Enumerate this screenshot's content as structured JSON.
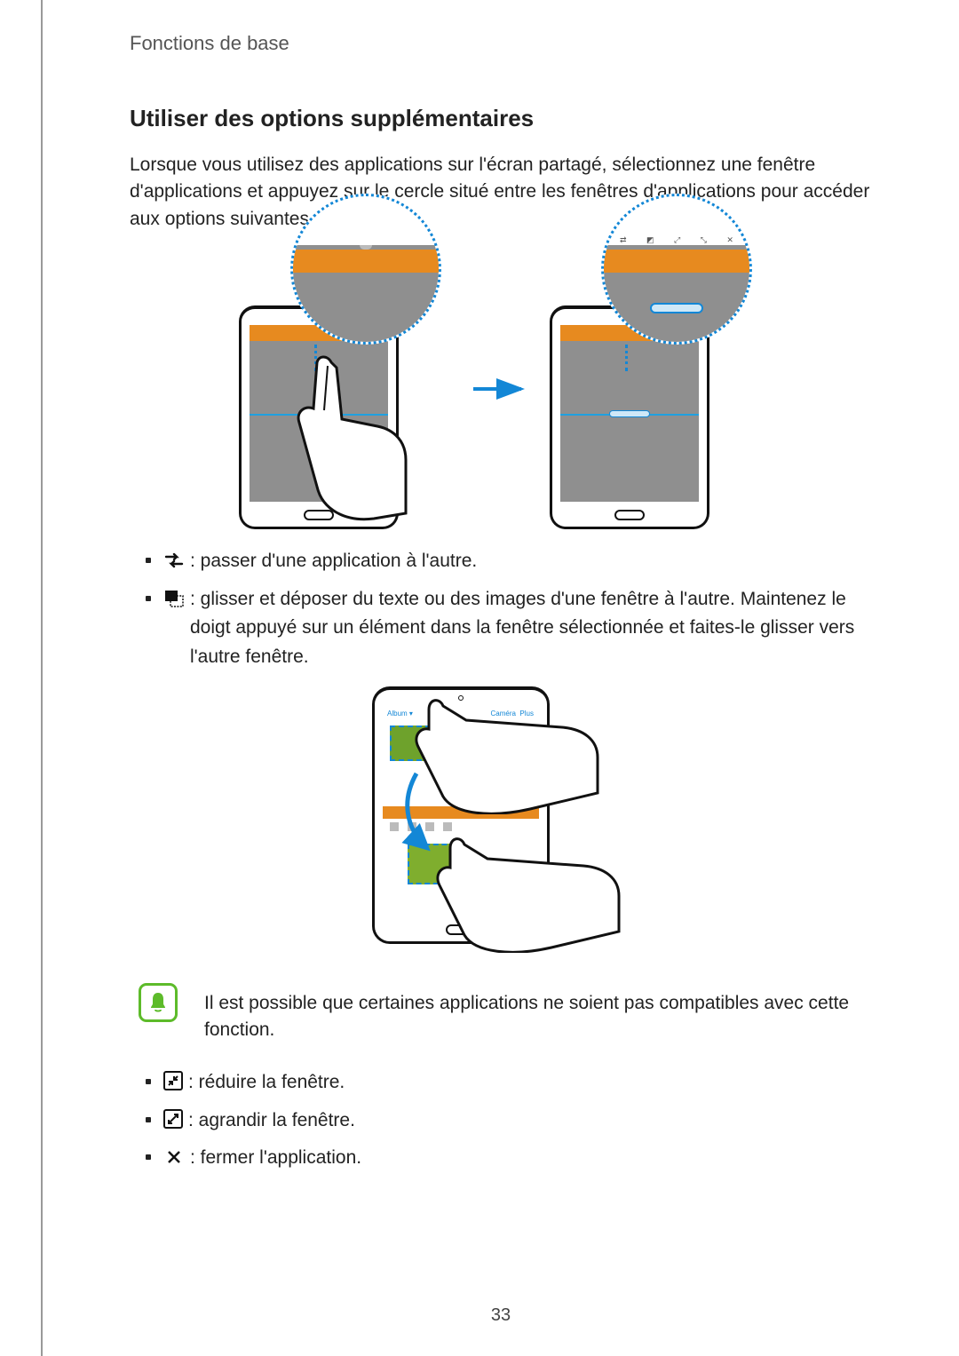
{
  "header": {
    "breadcrumb": "Fonctions de base"
  },
  "section": {
    "title": "Utiliser des options supplémentaires",
    "intro": "Lorsque vous utilisez des applications sur l'écran partagé, sélectionnez une fenêtre d'applications et appuyez sur le cercle situé entre les fenêtres d'applications pour accéder aux options suivantes :"
  },
  "bullets_top": [
    {
      "icon": "swap-icon",
      "text": " : passer d'une application à l'autre."
    },
    {
      "icon": "drag-drop-icon",
      "text": " : glisser et déposer du texte ou des images d'une fenêtre à l'autre. Maintenez le doigt appuyé sur un élément dans la fenêtre sélectionnée et faites-le glisser vers l'autre fenêtre."
    }
  ],
  "note": {
    "text": "Il est possible que certaines applications ne soient pas compatibles avec cette fonction."
  },
  "bullets_bottom": [
    {
      "icon": "minimize-icon",
      "text": " : réduire la fenêtre."
    },
    {
      "icon": "maximize-icon",
      "text": " : agrandir la fenêtre."
    },
    {
      "icon": "close-icon",
      "text": " : fermer l'application."
    }
  ],
  "page_number": "33"
}
